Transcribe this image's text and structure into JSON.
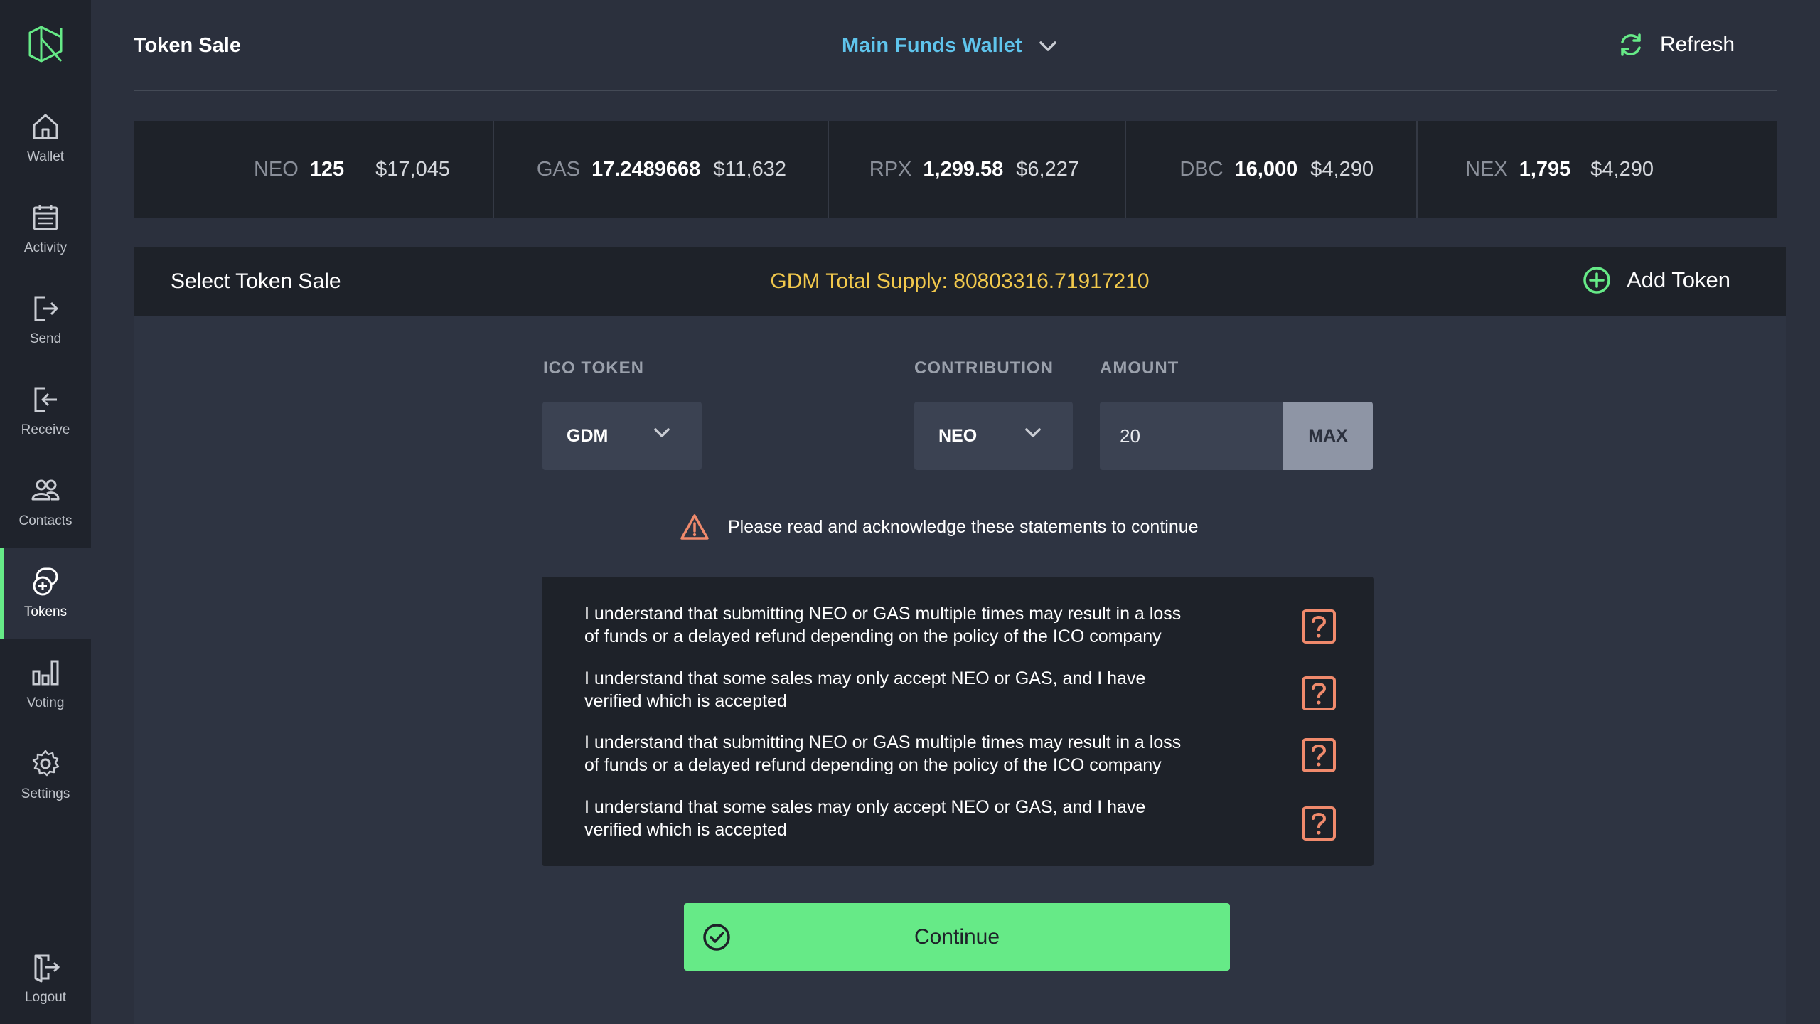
{
  "sidebar": {
    "logo": "neon-logo-icon",
    "items": [
      {
        "label": "Wallet",
        "icon": "home-icon"
      },
      {
        "label": "Activity",
        "icon": "calendar-icon"
      },
      {
        "label": "Send",
        "icon": "send-icon"
      },
      {
        "label": "Receive",
        "icon": "receive-icon"
      },
      {
        "label": "Contacts",
        "icon": "contacts-icon"
      },
      {
        "label": "Tokens",
        "icon": "tokens-icon",
        "active": true
      },
      {
        "label": "Voting",
        "icon": "bar-chart-icon"
      },
      {
        "label": "Settings",
        "icon": "gear-icon"
      }
    ],
    "logout": {
      "label": "Logout",
      "icon": "logout-icon"
    }
  },
  "header": {
    "title": "Token Sale",
    "wallet": "Main Funds Wallet",
    "refresh": "Refresh"
  },
  "balances": [
    {
      "symbol": "NEO",
      "amount": "125",
      "usd": "$17,045"
    },
    {
      "symbol": "GAS",
      "amount": "17.2489668",
      "usd": "$11,632"
    },
    {
      "symbol": "RPX",
      "amount": "1,299.58",
      "usd": "$6,227"
    },
    {
      "symbol": "DBC",
      "amount": "16,000",
      "usd": "$4,290"
    },
    {
      "symbol": "NEX",
      "amount": "1,795",
      "usd": "$4,290"
    }
  ],
  "panel": {
    "title": "Select Token Sale",
    "supply": "GDM Total Supply: 80803316.71917210",
    "add_token": "Add Token"
  },
  "form": {
    "ico_label": "ICO TOKEN",
    "ico_value": "GDM",
    "contribution_label": "CONTRIBUTION",
    "contribution_value": "NEO",
    "amount_label": "AMOUNT",
    "amount_value": "20",
    "max_label": "MAX"
  },
  "warning": "Please read and acknowledge these statements to continue",
  "statements": [
    {
      "line1": "I understand that submitting NEO or GAS multiple times may result in a loss",
      "line2": "of funds or a delayed refund depending on the policy of the ICO company"
    },
    {
      "line1": "I understand that some sales may only accept NEO or GAS, and I have",
      "line2": "verified which is accepted"
    },
    {
      "line1": "I understand that submitting NEO or GAS multiple times may result in a loss",
      "line2": "of funds or a delayed refund depending on the policy of the ICO company"
    },
    {
      "line1": "I understand that some sales may only accept NEO or GAS, and I have",
      "line2": "verified which is accepted"
    }
  ],
  "continue_label": "Continue",
  "colors": {
    "accent_green": "#66ea87",
    "wallet_blue": "#5fc4ec",
    "supply_yellow": "#f2c94c",
    "warning_orange": "#f08a6c"
  }
}
